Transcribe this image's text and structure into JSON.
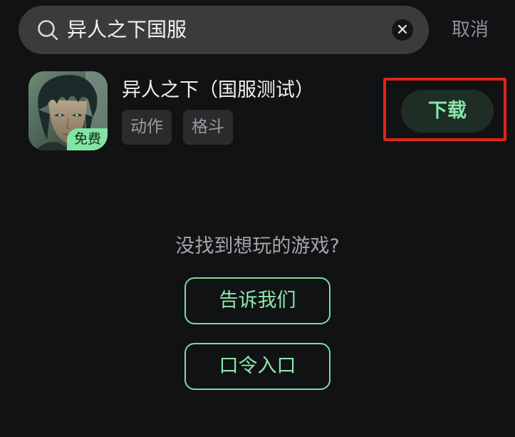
{
  "search": {
    "value": "异人之下国服",
    "cancel_label": "取消"
  },
  "result": {
    "title": "异人之下（国服测试）",
    "tags": [
      "动作",
      "格斗"
    ],
    "badge": "免费",
    "download_label": "下载"
  },
  "empty_state": {
    "prompt": "没找到想玩的游戏?",
    "tell_us_label": "告诉我们",
    "passcode_label": "口令入口"
  },
  "colors": {
    "background": "#111214",
    "accent_green": "#86e8a6",
    "highlight_red": "#e2231a"
  }
}
